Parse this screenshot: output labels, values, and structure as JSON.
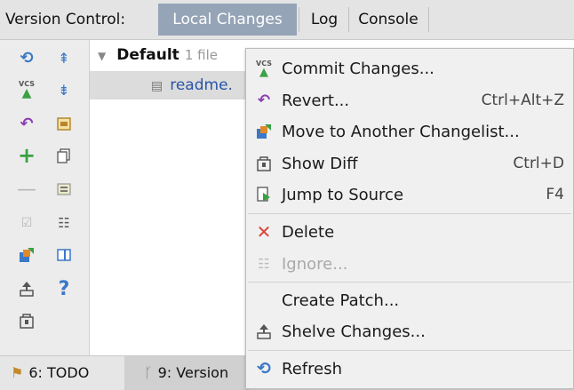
{
  "tabbar": {
    "prefix": "Version Control:",
    "tabs": [
      "Local Changes",
      "Log",
      "Console"
    ],
    "active": "Local Changes"
  },
  "tree": {
    "root_name": "Default",
    "root_count": "1 file",
    "file_name": "readme."
  },
  "menu": {
    "items": [
      {
        "label": "Commit Changes...",
        "shortcut": ""
      },
      {
        "label": "Revert...",
        "shortcut": "Ctrl+Alt+Z"
      },
      {
        "label": "Move to Another Changelist...",
        "shortcut": ""
      },
      {
        "label": "Show Diff",
        "shortcut": "Ctrl+D"
      },
      {
        "label": "Jump to Source",
        "shortcut": "F4"
      },
      {
        "label": "Delete",
        "shortcut": ""
      },
      {
        "label": "Ignore...",
        "shortcut": ""
      },
      {
        "label": "Create Patch...",
        "shortcut": ""
      },
      {
        "label": "Shelve Changes...",
        "shortcut": ""
      },
      {
        "label": "Refresh",
        "shortcut": ""
      }
    ]
  },
  "bottombar": {
    "todo": "6: TODO",
    "vcs": "9: Version"
  },
  "icons": {
    "vcs_label": "VCS",
    "help": "?"
  },
  "colors": {
    "active_tab": "#95a4b6",
    "file_link": "#2854a8",
    "green": "#3aa144",
    "red": "#d9443b",
    "purple": "#8a3fb0",
    "blue": "#3b78c7"
  }
}
